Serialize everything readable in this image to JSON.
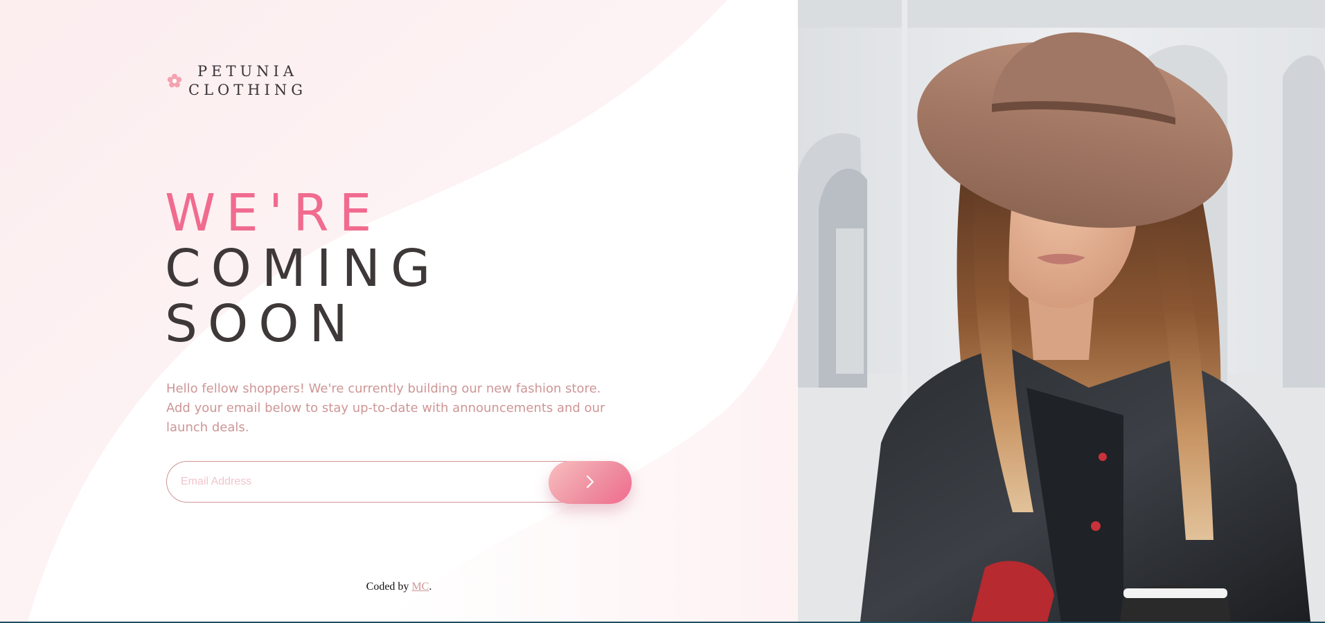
{
  "brand": {
    "line1": "PETUNIA",
    "line2": "CLOTHING",
    "icon": "flower-icon"
  },
  "headline": {
    "line1": "WE'RE",
    "line2": "COMING",
    "line3": "SOON"
  },
  "intro": "Hello fellow shoppers! We're currently building our new fashion store. Add your email below to stay up-to-date with announcements and our launch deals.",
  "form": {
    "email_placeholder": "Email Address",
    "submit_icon": "chevron-right-icon"
  },
  "footer": {
    "prefix": "Coded by ",
    "author": "MC",
    "suffix": "."
  },
  "hero_image": {
    "subject": "woman-in-hat-photo"
  },
  "colors": {
    "accent_pink": "#f16b8f",
    "desaturated_red": "#ce9595",
    "dark_grayish_red": "#3e3838",
    "soft_pink_bg": "#fdf0f1"
  }
}
